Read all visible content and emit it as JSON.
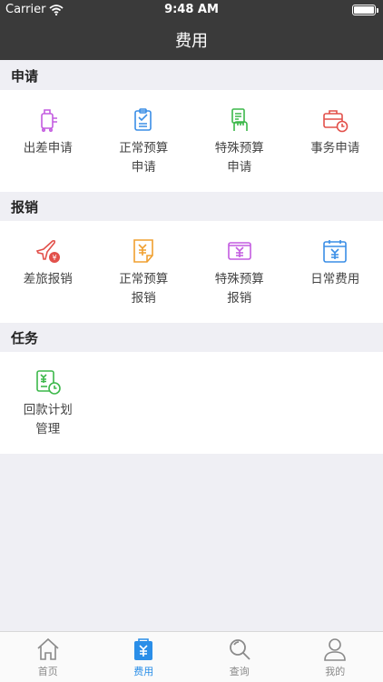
{
  "status": {
    "carrier": "Carrier",
    "time": "9:48 AM",
    "battery_level": 1.0
  },
  "nav": {
    "title": "费用"
  },
  "sections": [
    {
      "title": "申请",
      "items": [
        {
          "label": "出差申请",
          "icon": "luggage-icon",
          "color": "#c35ce0"
        },
        {
          "label": "正常预算申请",
          "icon": "clipboard-check-icon",
          "color": "#3a8ee6"
        },
        {
          "label": "特殊预算申请",
          "icon": "hand-document-icon",
          "color": "#3cb84a"
        },
        {
          "label": "事务申请",
          "icon": "briefcase-clock-icon",
          "color": "#e2504a"
        }
      ]
    },
    {
      "title": "报销",
      "items": [
        {
          "label": "差旅报销",
          "icon": "plane-yen-icon",
          "color": "#e2504a"
        },
        {
          "label": "正常预算报销",
          "icon": "yen-document-icon",
          "color": "#f0a030"
        },
        {
          "label": "特殊预算报销",
          "icon": "yen-wallet-icon",
          "color": "#c35ce0"
        },
        {
          "label": "日常费用",
          "icon": "yen-calendar-icon",
          "color": "#3a8ee6"
        }
      ]
    },
    {
      "title": "任务",
      "items": [
        {
          "label": "回款计划管理",
          "icon": "yen-plan-clock-icon",
          "color": "#3cb84a"
        }
      ]
    }
  ],
  "tabs": [
    {
      "label": "首页",
      "icon": "home-icon",
      "active": false
    },
    {
      "label": "费用",
      "icon": "yen-bag-icon",
      "active": true
    },
    {
      "label": "查询",
      "icon": "search-icon",
      "active": false
    },
    {
      "label": "我的",
      "icon": "person-icon",
      "active": false
    }
  ]
}
